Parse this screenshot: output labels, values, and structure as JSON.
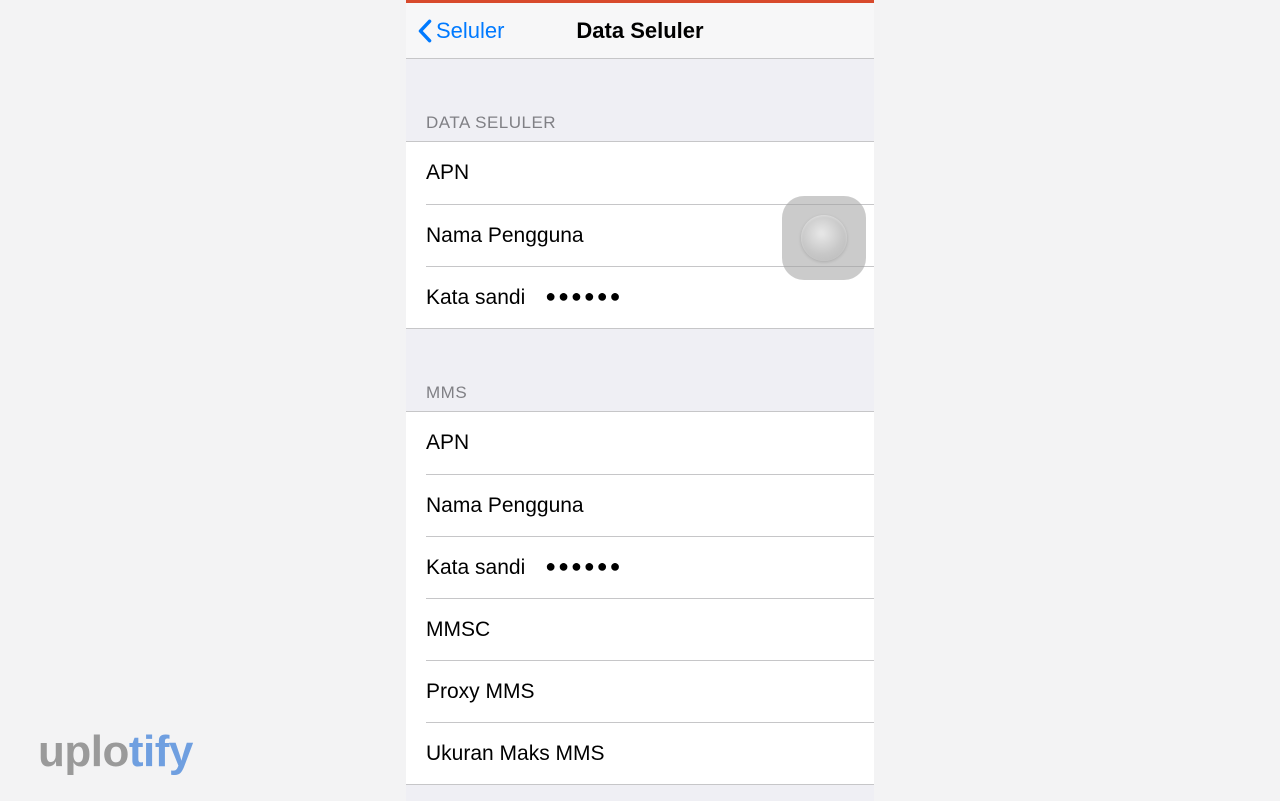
{
  "nav": {
    "back_label": "Seluler",
    "title": "Data Seluler"
  },
  "sections": {
    "cellular": {
      "header": "DATA SELULER",
      "rows": {
        "apn": {
          "label": "APN"
        },
        "username": {
          "label": "Nama Pengguna"
        },
        "password": {
          "label": "Kata sandi",
          "value": "●●●●●●"
        }
      }
    },
    "mms": {
      "header": "MMS",
      "rows": {
        "apn": {
          "label": "APN"
        },
        "username": {
          "label": "Nama Pengguna"
        },
        "password": {
          "label": "Kata sandi",
          "value": "●●●●●●"
        },
        "mmsc": {
          "label": "MMSC"
        },
        "proxy": {
          "label": "Proxy MMS"
        },
        "maxsize": {
          "label": "Ukuran Maks MMS"
        }
      }
    }
  },
  "watermark": {
    "part1": "uplo",
    "part2": "tify"
  }
}
